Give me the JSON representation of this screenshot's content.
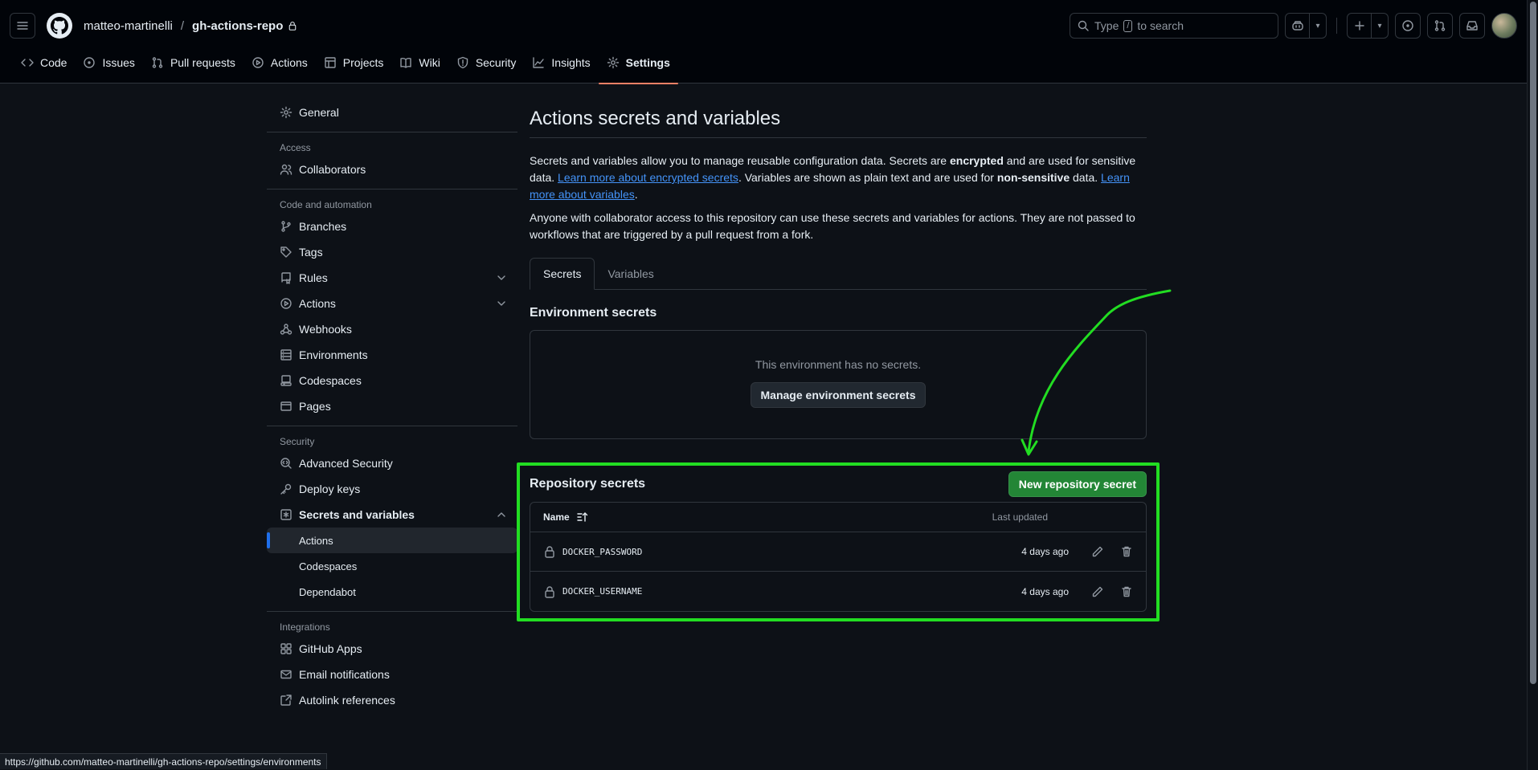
{
  "header": {
    "owner": "matteo-martinelli",
    "separator": "/",
    "repo": "gh-actions-repo",
    "search_placeholder": "Type",
    "search_key": "/",
    "search_suffix": "to search"
  },
  "repo_nav": {
    "tabs": [
      {
        "label": "Code",
        "icon": "code-icon"
      },
      {
        "label": "Issues",
        "icon": "issue-icon"
      },
      {
        "label": "Pull requests",
        "icon": "pull-request-icon"
      },
      {
        "label": "Actions",
        "icon": "play-icon"
      },
      {
        "label": "Projects",
        "icon": "table-icon"
      },
      {
        "label": "Wiki",
        "icon": "book-icon"
      },
      {
        "label": "Security",
        "icon": "shield-icon"
      },
      {
        "label": "Insights",
        "icon": "graph-icon"
      },
      {
        "label": "Settings",
        "icon": "gear-icon"
      }
    ],
    "active": "Settings"
  },
  "sidebar": {
    "general": "General",
    "access_heading": "Access",
    "collaborators": "Collaborators",
    "code_heading": "Code and automation",
    "branches": "Branches",
    "tags": "Tags",
    "rules": "Rules",
    "actions": "Actions",
    "webhooks": "Webhooks",
    "environments": "Environments",
    "codespaces": "Codespaces",
    "pages": "Pages",
    "security_heading": "Security",
    "advanced_security": "Advanced Security",
    "deploy_keys": "Deploy keys",
    "secrets_variables": "Secrets and variables",
    "sub_actions": "Actions",
    "sub_codespaces": "Codespaces",
    "sub_dependabot": "Dependabot",
    "integrations_heading": "Integrations",
    "github_apps": "GitHub Apps",
    "email_notifications": "Email notifications",
    "autolink_references": "Autolink references"
  },
  "main": {
    "title": "Actions secrets and variables",
    "desc_1": "Secrets and variables allow you to manage reusable configuration data. Secrets are ",
    "desc_encrypted": "encrypted",
    "desc_2": " and are used for sensitive data. ",
    "desc_link1": "Learn more about encrypted secrets",
    "desc_3": ". Variables are shown as plain text and are used for ",
    "desc_nonsensitive": "non-sensitive",
    "desc_4": " data. ",
    "desc_link2": "Learn more about variables",
    "desc_5": ".",
    "desc2": "Anyone with collaborator access to this repository can use these secrets and variables for actions. They are not passed to workflows that are triggered by a pull request from a fork.",
    "tab_secrets": "Secrets",
    "tab_variables": "Variables",
    "env_title": "Environment secrets",
    "env_empty": "This environment has no secrets.",
    "env_button": "Manage environment secrets",
    "repo_title": "Repository secrets",
    "new_secret_button": "New repository secret",
    "col_name": "Name",
    "col_updated": "Last updated",
    "secrets": [
      {
        "name": "DOCKER_PASSWORD",
        "updated": "4 days ago"
      },
      {
        "name": "DOCKER_USERNAME",
        "updated": "4 days ago"
      }
    ]
  },
  "status_url": "https://github.com/matteo-martinelli/gh-actions-repo/settings/environments",
  "colors": {
    "background": "#0d1117",
    "header": "#010409",
    "accent_green": "#238636",
    "link": "#4493f8",
    "annotation": "#22dd22",
    "active_tab_underline": "#f78166"
  }
}
